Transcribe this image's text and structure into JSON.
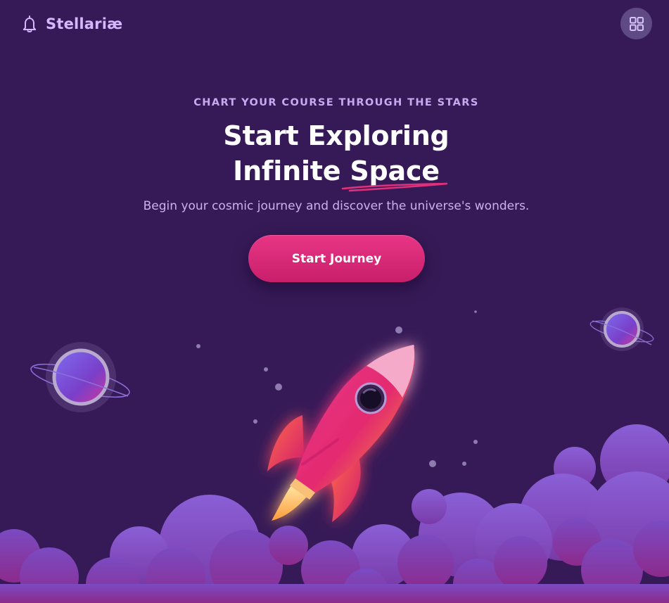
{
  "header": {
    "brand_name": "Stellariæ",
    "brand_icon": "bell-icon",
    "menu_icon": "grid-icon"
  },
  "hero": {
    "eyebrow": "CHART YOUR COURSE THROUGH THE STARS",
    "title_line1": "Start Exploring",
    "title_line2_plain": "Infinite ",
    "title_line2_accent": "Space",
    "subtitle": "Begin your cosmic journey and discover the universe's wonders.",
    "cta_label": "Start Journey"
  },
  "colors": {
    "background": "#361a57",
    "brand_text": "#d3b8ff",
    "eyebrow": "#c9a8f2",
    "cta": "#e0307c",
    "underline": "#e0307c",
    "cloud": "#7d4fc4"
  }
}
